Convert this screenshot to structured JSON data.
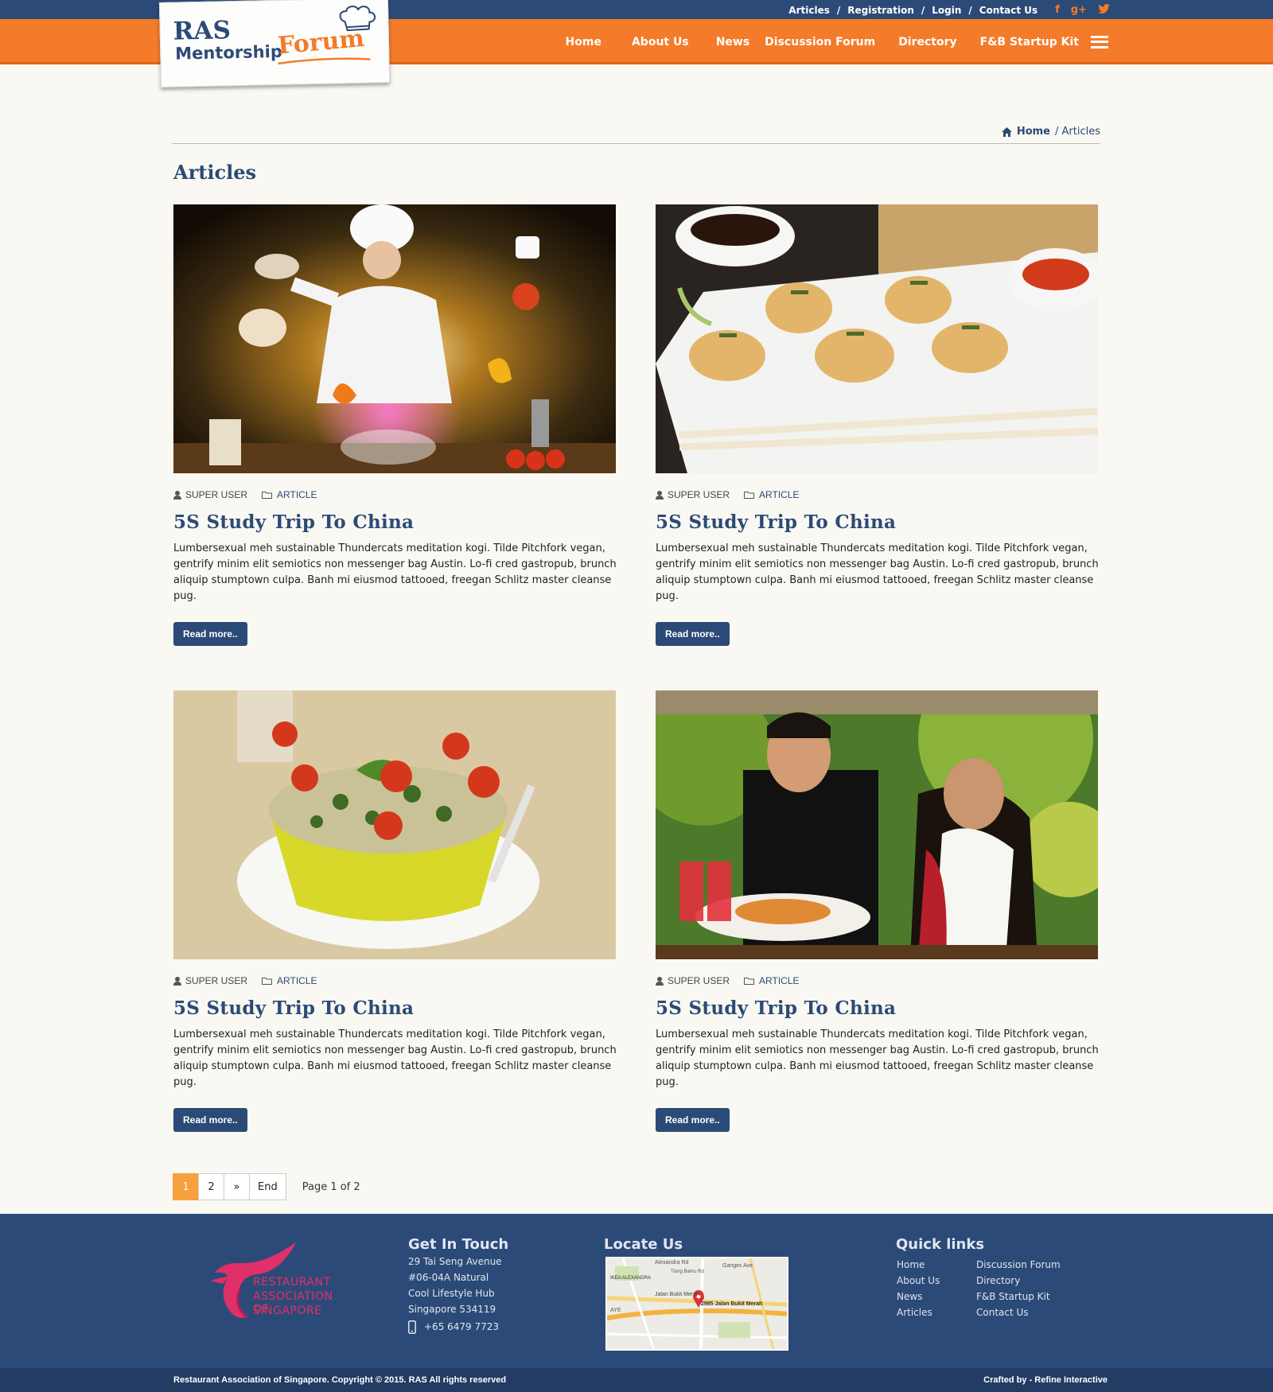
{
  "topbar": {
    "links": [
      "Articles",
      "Registration",
      "Login",
      "Contact Us"
    ],
    "social": [
      "facebook-icon",
      "google-plus-icon",
      "twitter-icon"
    ]
  },
  "logo": {
    "line1": "RAS",
    "line2": "Mentorship",
    "line3": "Forum"
  },
  "nav": {
    "items": [
      "Home",
      "About Us",
      "News",
      "Discussion Forum",
      "Directory",
      "F&B Startup Kit"
    ]
  },
  "breadcrumb": {
    "home": "Home",
    "current": "/ Articles"
  },
  "page": {
    "title": "Articles"
  },
  "articles": [
    {
      "author": "SUPER USER",
      "category": "ARTICLE",
      "title": "5S Study Trip To China",
      "excerpt": "Lumbersexual meh sustainable Thundercats meditation kogi. Tilde Pitchfork vegan, gentrify minim elit semiotics non messenger bag Austin. Lo-fi cred gastropub, brunch aliquip stumptown culpa. Banh mi eiusmod tattooed, freegan Schlitz master cleanse pug.",
      "button": "Read more.."
    },
    {
      "author": "SUPER USER",
      "category": "ARTICLE",
      "title": "5S Study Trip To China",
      "excerpt": "Lumbersexual meh sustainable Thundercats meditation kogi. Tilde Pitchfork vegan, gentrify minim elit semiotics non messenger bag Austin. Lo-fi cred gastropub, brunch aliquip stumptown culpa. Banh mi eiusmod tattooed, freegan Schlitz master cleanse pug.",
      "button": "Read more.."
    },
    {
      "author": "SUPER USER",
      "category": "ARTICLE",
      "title": "5S Study Trip To China",
      "excerpt": "Lumbersexual meh sustainable Thundercats meditation kogi. Tilde Pitchfork vegan, gentrify minim elit semiotics non messenger bag Austin. Lo-fi cred gastropub, brunch aliquip stumptown culpa. Banh mi eiusmod tattooed, freegan Schlitz master cleanse pug.",
      "button": "Read more.."
    },
    {
      "author": "SUPER USER",
      "category": "ARTICLE",
      "title": "5S Study Trip To China",
      "excerpt": "Lumbersexual meh sustainable Thundercats meditation kogi. Tilde Pitchfork vegan, gentrify minim elit semiotics non messenger bag Austin. Lo-fi cred gastropub, brunch aliquip stumptown culpa. Banh mi eiusmod tattooed, freegan Schlitz master cleanse pug.",
      "button": "Read more.."
    }
  ],
  "pagination": {
    "pages": [
      "1",
      "2"
    ],
    "next": "»",
    "end": "End",
    "info": "Page 1 of 2",
    "current": 1
  },
  "footer": {
    "logo_lines": [
      "RESTAURANT",
      "ASSOCIATION OF",
      "SINGAPORE"
    ],
    "contact_title": "Get In Touch",
    "address": [
      "29 Tai Seng Avenue",
      "#06-04A Natural",
      "Cool Lifestyle Hub",
      "Singapore 534119"
    ],
    "phone": "+65 6479 7723",
    "locate_title": "Locate Us",
    "map_labels": [
      "Alexandra Rd",
      "Ganges Ave",
      "IKEA ALEXANDRA",
      "Jalan Bukit Merah",
      "2985 Jalan Bukit Merah",
      "AYE",
      "Tiong Bahru Rd"
    ],
    "quicklinks_title": "Quick links",
    "quicklinks_col1": [
      "Home",
      "About Us",
      "News",
      "Articles"
    ],
    "quicklinks_col2": [
      "Discussion Forum",
      "Directory",
      "F&B Startup Kit",
      "Contact Us"
    ],
    "copyright": "Restaurant Association of Singapore. Copyright © 2015. RAS All rights reserved",
    "credit": "Crafted by - Refine Interactive"
  },
  "colors": {
    "navy": "#2c4a77",
    "orange": "#f47b2a",
    "background": "#f9f8f2",
    "pink": "#e0306a"
  }
}
